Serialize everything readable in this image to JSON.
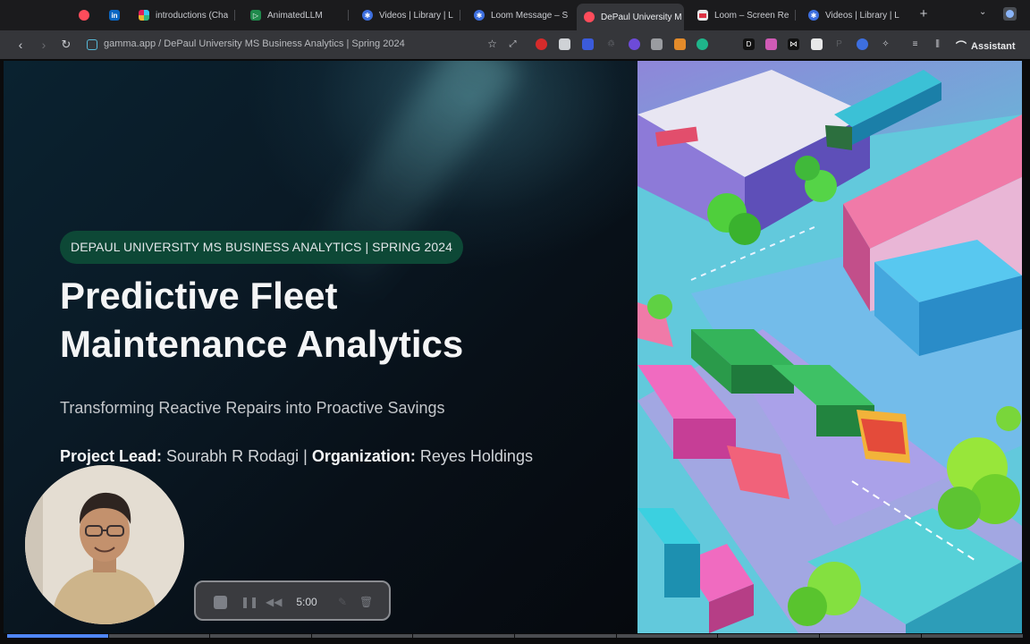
{
  "tabs": [
    {
      "label": "",
      "icon": "record-icon",
      "color": "#ff4c5b"
    },
    {
      "label": "in",
      "icon": "linkedin-icon",
      "color": "#0a66c2"
    },
    {
      "label": "introductions (Cha",
      "icon": "slack-icon",
      "color": "#e01e5a"
    },
    {
      "label": "AnimatedLLM",
      "icon": "play-icon",
      "color": "#1f8a4c"
    },
    {
      "label": "Videos | Library | L",
      "icon": "loom-icon",
      "color": "#3d6fe0"
    },
    {
      "label": "Loom Message – S",
      "icon": "loom-icon",
      "color": "#3d6fe0"
    },
    {
      "label": "DePaul University M",
      "icon": "record-icon",
      "color": "#ff4c5b",
      "active": true
    },
    {
      "label": "Loom – Screen Re",
      "icon": "image-icon",
      "color": "#e9e9ea"
    },
    {
      "label": "Videos | Library | L",
      "icon": "loom-icon",
      "color": "#3d6fe0"
    }
  ],
  "toolbar": {
    "url": "gamma.app / DePaul University MS Business Analytics | Spring 2024",
    "assistant_label": "Assistant"
  },
  "slide": {
    "badge": "DEPAUL UNIVERSITY MS BUSINESS ANALYTICS | SPRING 2024",
    "title_line1": "Predictive Fleet",
    "title_line2": "Maintenance Analytics",
    "subtitle": "Transforming Reactive Repairs into Proactive Savings",
    "lead_label": "Project Lead:",
    "lead_name": "Sourabh R Rodagi",
    "org_label": "Organization:",
    "org_name": "Reyes Holdings"
  },
  "recorder": {
    "time": "5:00"
  },
  "progress": {
    "played_fraction": 0.1
  },
  "colors": {
    "badge_bg": "#0d4836",
    "accent": "#4f86f7",
    "active_tab": "#35363a"
  }
}
